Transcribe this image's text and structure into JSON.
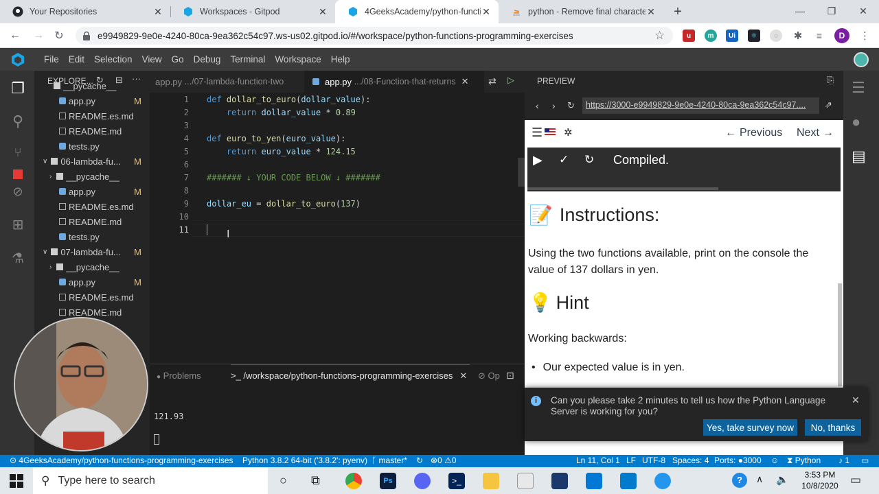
{
  "browser": {
    "tabs": [
      {
        "title": "Your Repositories"
      },
      {
        "title": "Workspaces - Gitpod"
      },
      {
        "title": "4GeeksAcademy/python-functio"
      },
      {
        "title": "python - Remove final character"
      }
    ],
    "url": "e9949829-9e0e-4240-80ca-9ea362c54c97.ws-us02.gitpod.io/#/workspace/python-functions-programming-exercises",
    "profile_initial": "D"
  },
  "menu": [
    "File",
    "Edit",
    "Selection",
    "View",
    "Go",
    "Debug",
    "Terminal",
    "Workspace",
    "Help"
  ],
  "explorer": {
    "title": "EXPLORE...",
    "items": [
      {
        "label": "__pycache__",
        "type": "folder",
        "badge": ""
      },
      {
        "label": "app.py",
        "type": "py",
        "badge": "M"
      },
      {
        "label": "README.es.md",
        "type": "md",
        "badge": ""
      },
      {
        "label": "README.md",
        "type": "md",
        "badge": ""
      },
      {
        "label": "tests.py",
        "type": "py",
        "badge": ""
      },
      {
        "label": "06-lambda-fu...",
        "type": "openfolder",
        "badge": "M"
      },
      {
        "label": "__pycache__",
        "type": "folder",
        "badge": ""
      },
      {
        "label": "app.py",
        "type": "py",
        "badge": "M"
      },
      {
        "label": "README.es.md",
        "type": "md",
        "badge": ""
      },
      {
        "label": "README.md",
        "type": "md",
        "badge": ""
      },
      {
        "label": "tests.py",
        "type": "py",
        "badge": ""
      },
      {
        "label": "07-lambda-fu...",
        "type": "openfolder",
        "badge": "M"
      },
      {
        "label": "__pycache__",
        "type": "folder",
        "badge": ""
      },
      {
        "label": "app.py",
        "type": "py",
        "badge": "M"
      },
      {
        "label": "README.es.md",
        "type": "md",
        "badge": ""
      },
      {
        "label": "README.md",
        "type": "md",
        "badge": ""
      }
    ]
  },
  "editor": {
    "tab1": "app.py",
    "tab1_path": ".../07-lambda-function-two",
    "tab2": "app.py",
    "tab2_path": ".../08-Function-that-returns",
    "line_numbers": [
      "1",
      "2",
      "3",
      "4",
      "5",
      "6",
      "7",
      "8",
      "9",
      "10",
      "11"
    ]
  },
  "panel": {
    "problems": "Problems",
    "terminal_title": ">_ /workspace/python-functions-programming-exercises",
    "output_label": "Op",
    "output": "121.93"
  },
  "preview": {
    "title": "PREVIEW",
    "url": "https://3000-e9949829-9e0e-4240-80ca-9ea362c54c97....",
    "previous": "Previous",
    "next": "Next",
    "status": "Compiled.",
    "instructions_heading": "Instructions:",
    "instructions_text": "Using the two functions available, print on the console the value of 137 dollars in yen.",
    "hint_heading": "Hint",
    "hint_text": "Working backwards:",
    "hint_bullet": "Our expected value is in yen."
  },
  "notification": {
    "message": "Can you please take 2 minutes to tell us how the Python Language Server is working for you?",
    "accept": "Yes, take survey now",
    "decline": "No, thanks"
  },
  "statusbar": {
    "repo": "4GeeksAcademy/python-functions-programming-exercises",
    "python": "Python 3.8.2 64-bit ('3.8.2': pyenv)",
    "branch": "master*",
    "problems": "0",
    "warnings": "0",
    "position": "Ln 11, Col 1",
    "eol": "LF",
    "encoding": "UTF-8",
    "spaces": "Spaces: 4",
    "ports": "Ports:",
    "port": "3000",
    "language": "Python",
    "bell": "1"
  },
  "taskbar": {
    "search_placeholder": "Type here to search",
    "time": "3:53 PM",
    "date": "10/8/2020"
  },
  "colors": {
    "accent": "#007acc",
    "editor_bg": "#1e1e1e",
    "button": "#0e639c"
  }
}
